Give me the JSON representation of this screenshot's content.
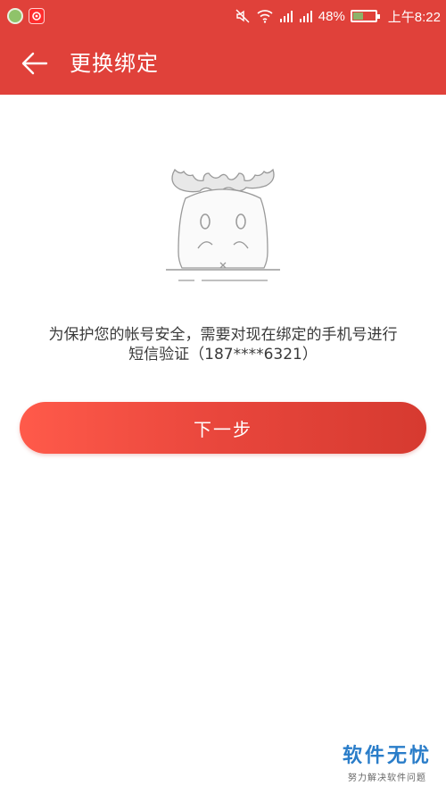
{
  "status_bar": {
    "battery_percent": "48%",
    "time": "上午8:22",
    "battery_level": 0.48,
    "icons": [
      "mute-icon",
      "wifi-icon",
      "signal-icon",
      "signal-icon"
    ]
  },
  "app_bar": {
    "title": "更换绑定",
    "back_icon": "arrow-left-icon",
    "color": "#e0413a"
  },
  "illustration": {
    "icon": "moose-mascot-icon"
  },
  "main": {
    "message_line1": "为保护您的帐号安全，需要对现在绑定的手机号进行",
    "message_line2": "短信验证（187****6321）",
    "next_button_label": "下一步",
    "button_color": "#e8463c"
  },
  "watermark": {
    "title": "软件无忧",
    "subtitle": "努力解决软件问题",
    "color": "#2a7dc9"
  }
}
